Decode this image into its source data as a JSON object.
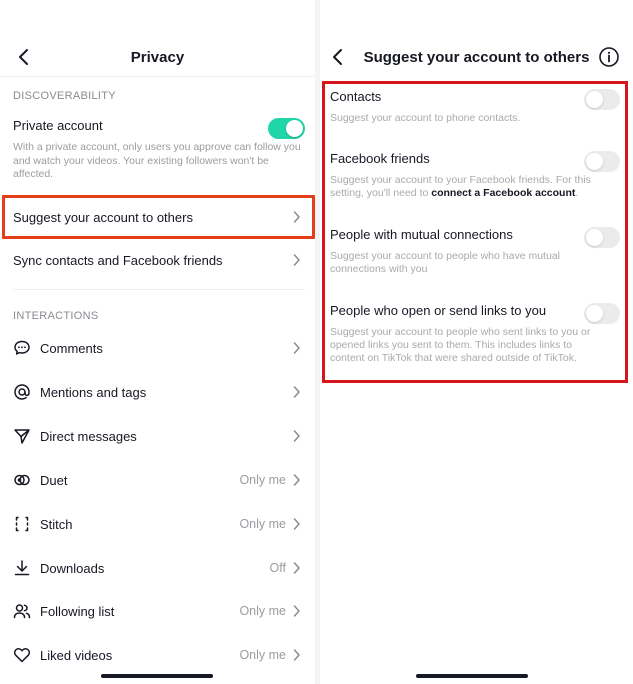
{
  "left": {
    "title": "Privacy",
    "discoverability_label": "DISCOVERABILITY",
    "private_account": {
      "label": "Private account",
      "enabled": true,
      "description": "With a private account, only users you approve can follow you and watch your videos. Your existing followers won't be affected."
    },
    "suggest_label": "Suggest your account to others",
    "sync_label": "Sync contacts and Facebook friends",
    "interactions_label": "INTERACTIONS",
    "items": [
      {
        "label": "Comments",
        "value": "",
        "icon": "comment-icon"
      },
      {
        "label": "Mentions and tags",
        "value": "",
        "icon": "at-sign-icon"
      },
      {
        "label": "Direct messages",
        "value": "",
        "icon": "send-icon"
      },
      {
        "label": "Duet",
        "value": "Only me",
        "icon": "duet-icon"
      },
      {
        "label": "Stitch",
        "value": "Only me",
        "icon": "stitch-icon"
      },
      {
        "label": "Downloads",
        "value": "Off",
        "icon": "download-icon"
      },
      {
        "label": "Following list",
        "value": "Only me",
        "icon": "users-icon"
      },
      {
        "label": "Liked videos",
        "value": "Only me",
        "icon": "heart-icon"
      }
    ]
  },
  "right": {
    "title": "Suggest your account to others",
    "options": [
      {
        "label": "Contacts",
        "enabled": false,
        "description": "Suggest your account to phone contacts."
      },
      {
        "label": "Facebook friends",
        "enabled": false,
        "description_prefix": "Suggest your account to your Facebook friends. For this setting, you'll need to ",
        "description_link": "connect a Facebook account",
        "description_suffix": "."
      },
      {
        "label": "People with mutual connections",
        "enabled": false,
        "description": "Suggest your account to people who have mutual connections with you"
      },
      {
        "label": "People who open or send links to you",
        "enabled": false,
        "description": "Suggest your account to people who sent links to you or opened links you sent to them. This includes links to content on TikTok that were shared outside of TikTok."
      }
    ]
  },
  "colors": {
    "toggle_on": "#20d5a8",
    "highlight": "#e53d18"
  }
}
